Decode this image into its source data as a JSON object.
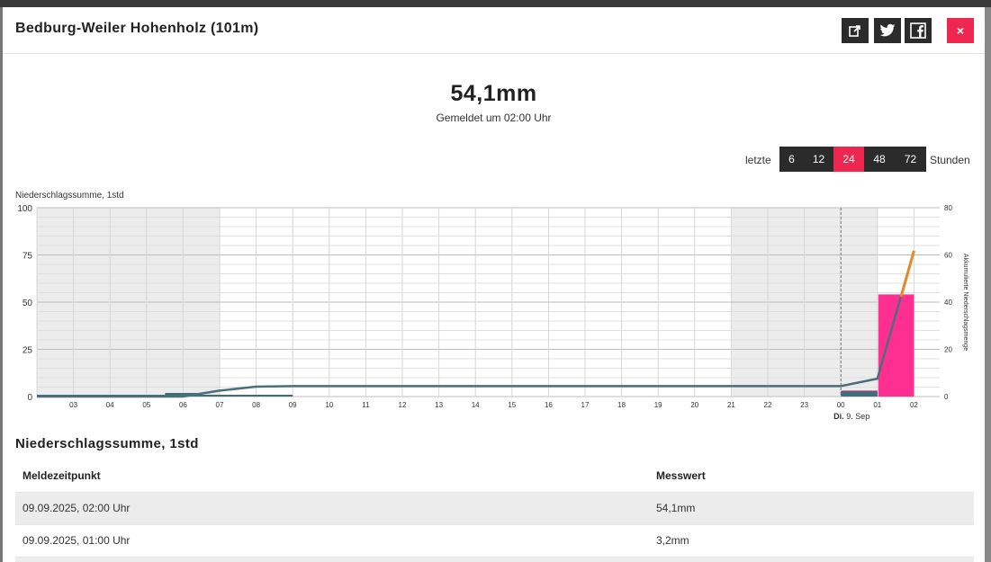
{
  "modal": {
    "title": "Bedburg-Weiler Hohenholz (101m)",
    "share_buttons": [
      {
        "label": "Teilen",
        "icon": "share-icon"
      },
      {
        "label": "Twitter",
        "icon": "twitter-icon"
      },
      {
        "label": "Facebook",
        "icon": "facebook-icon"
      }
    ],
    "close_label": "×"
  },
  "current": {
    "value": "54,1mm",
    "reported_at": "Gemeldet um 02:00 Uhr"
  },
  "range": {
    "prefix": "letzte",
    "suffix": "Stunden",
    "options": [
      "6",
      "12",
      "24",
      "48",
      "72"
    ],
    "active": "24"
  },
  "chart_data": {
    "type": "bar",
    "title": "Niederschlagssumme, 1std",
    "ylabel_left": "",
    "ylabel_right": "Akkumulierte Niederschlagsmenge",
    "ylim_left": [
      0,
      100
    ],
    "yticks_left": [
      0,
      25,
      50,
      75,
      100
    ],
    "ylim_right": [
      0,
      80
    ],
    "yticks_right": [
      0,
      20,
      40,
      60,
      80
    ],
    "x_ticks": [
      "03",
      "04",
      "05",
      "06",
      "07",
      "08",
      "09",
      "10",
      "11",
      "12",
      "13",
      "14",
      "15",
      "16",
      "17",
      "18",
      "19",
      "20",
      "21",
      "22",
      "23",
      "00",
      "01",
      "02"
    ],
    "date_label_bold": "Di.",
    "date_label": "9. Sep",
    "grid": true,
    "series": [
      {
        "type": "bar",
        "color": "#ff2f92",
        "x": [
          "03",
          "04",
          "05",
          "06",
          "07",
          "08",
          "09",
          "10",
          "11",
          "12",
          "13",
          "14",
          "15",
          "16",
          "17",
          "18",
          "19",
          "20",
          "21",
          "22",
          "23",
          "00",
          "01",
          "02"
        ],
        "values": [
          0,
          0,
          0,
          0,
          0,
          0,
          0,
          0,
          0,
          0,
          0,
          0,
          0,
          0,
          0,
          0,
          0,
          0,
          0,
          0,
          0,
          0,
          3.2,
          54.1
        ]
      },
      {
        "type": "line",
        "axis": "right",
        "color": "#4d6e7a",
        "x": [
          "03",
          "04",
          "05",
          "06",
          "07",
          "08",
          "09",
          "10",
          "11",
          "12",
          "13",
          "14",
          "15",
          "16",
          "17",
          "18",
          "19",
          "20",
          "21",
          "22",
          "23",
          "00",
          "01",
          "02"
        ],
        "values": [
          0,
          0,
          0,
          0,
          2.5,
          4.2,
          4.4,
          4.4,
          4.4,
          4.4,
          4.4,
          4.4,
          4.4,
          4.4,
          4.4,
          4.4,
          4.4,
          4.4,
          4.4,
          4.4,
          4.4,
          4.4,
          7.6,
          61.7
        ]
      }
    ]
  },
  "table": {
    "title": "Niederschlagssumme, 1std",
    "headers": [
      "Meldezeitpunkt",
      "Messwert"
    ],
    "rows": [
      [
        "09.09.2025, 02:00 Uhr",
        "54,1mm"
      ],
      [
        "09.09.2025, 01:00 Uhr",
        "3,2mm"
      ]
    ]
  }
}
